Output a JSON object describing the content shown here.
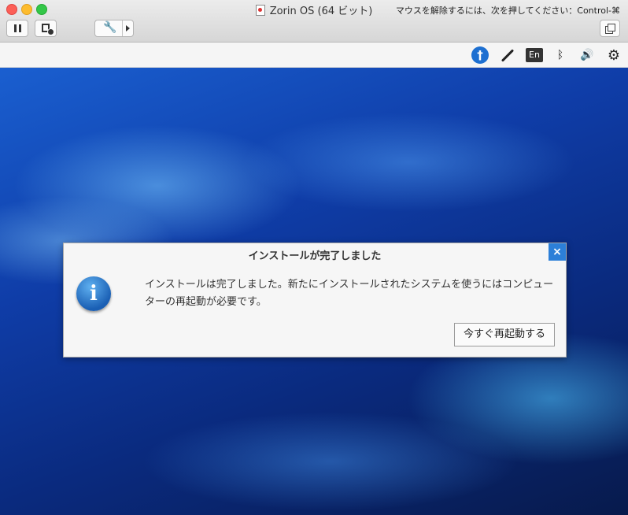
{
  "window": {
    "title": "Zorin OS (64 ビット)",
    "release_hint": "マウスを解除するには、次を押してください：Control-⌘"
  },
  "panel": {
    "language": "En",
    "accessibility_glyph": "†"
  },
  "dialog": {
    "title": "インストールが完了しました",
    "close_glyph": "×",
    "info_glyph": "i",
    "message": "インストールは完了しました。新たにインストールされたシステムを使うにはコンピューターの再起動が必要です。",
    "restart_button": "今すぐ再起動する"
  },
  "colors": {
    "accent": "#2c7fd8",
    "desktop": "#0f3da8"
  }
}
